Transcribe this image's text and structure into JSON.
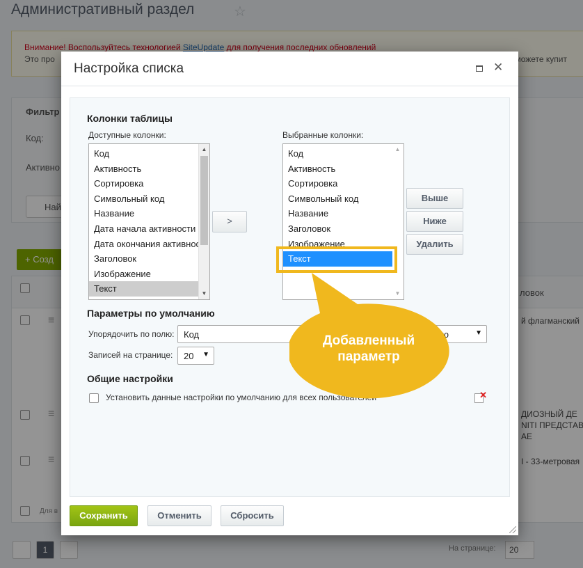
{
  "background": {
    "page_title": "Административный раздел",
    "notice_warning_prefix": "Внимание! Воспользуйтесь технологией ",
    "notice_link": "SiteUpdate",
    "notice_warning_suffix": " для получения последних обновлений",
    "notice_line2": "Это про",
    "notice_right": "можете купит",
    "filter_title": "Фильтр",
    "filter_code": "Код:",
    "filter_active": "Активно",
    "find_button": "Най",
    "add_button": "+ Созд",
    "table_header": "ловок",
    "row1_text": "й флагманский",
    "row2_text": "ДИОЗНЫЙ ДЕ\nNITI ПРЕДСТАВ\nAE",
    "row3_text": "I - 33-метровая",
    "footer_text": "Для в",
    "pager_current": "1",
    "per_page_label": "На странице:",
    "per_page_value": "20"
  },
  "dialog": {
    "title": "Настройка списка",
    "columns_section_title": "Колонки таблицы",
    "available_label": "Доступные колонки:",
    "selected_label": "Выбранные колонки:",
    "available_columns": [
      "Код",
      "Активность",
      "Сортировка",
      "Символьный код",
      "Название",
      "Дата начала активности",
      "Дата окончания активности",
      "Заголовок",
      "Изображение",
      "Текст"
    ],
    "available_selected": "Текст",
    "selected_columns": [
      "Код",
      "Активность",
      "Сортировка",
      "Символьный код",
      "Название",
      "Заголовок",
      "Изображение",
      "Текст"
    ],
    "selected_selected": "Текст",
    "move_right_button": ">",
    "up_button": "Выше",
    "down_button": "Ниже",
    "remove_button": "Удалить",
    "defaults_section_title": "Параметры по умолчанию",
    "sort_by_label": "Упорядочить по полю:",
    "sort_by_value": "Код",
    "sort_order_value": "ию",
    "per_page_label": "Записей на странице:",
    "per_page_value": "20",
    "general_section_title": "Общие настройки",
    "apply_all_label": "Установить данные настройки по умолчанию для всех пользователей",
    "apply_all_checked": false,
    "save_button": "Сохранить",
    "cancel_button": "Отменить",
    "reset_button": "Сбросить"
  },
  "annotation": {
    "callout_text_line1": "Добавленный",
    "callout_text_line2": "параметр",
    "accent_color": "#f0b81e"
  }
}
